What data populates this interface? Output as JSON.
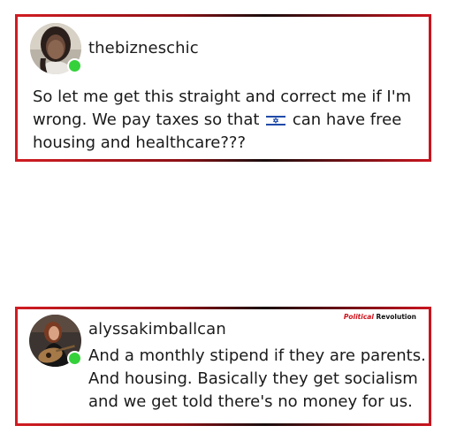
{
  "posts": [
    {
      "username": "thebizneschic",
      "online": true,
      "text_before_flag": "So let me get this straight and correct me if I'm wrong. We pay taxes so that ",
      "flag_icon": "israel-flag-icon",
      "text_after_flag": " can have free housing and healthcare???"
    },
    {
      "username": "alyssakimballcan",
      "online": true,
      "text": "And a monthly stipend if they are parents. And housing. Basically they get socialism and we get told there's no money for us.",
      "watermark": {
        "part1": "Political",
        "part2": " Revolution"
      }
    }
  ],
  "colors": {
    "card_border": "#c8141e",
    "online_dot": "#35d13b",
    "watermark_red": "#d0121b"
  }
}
